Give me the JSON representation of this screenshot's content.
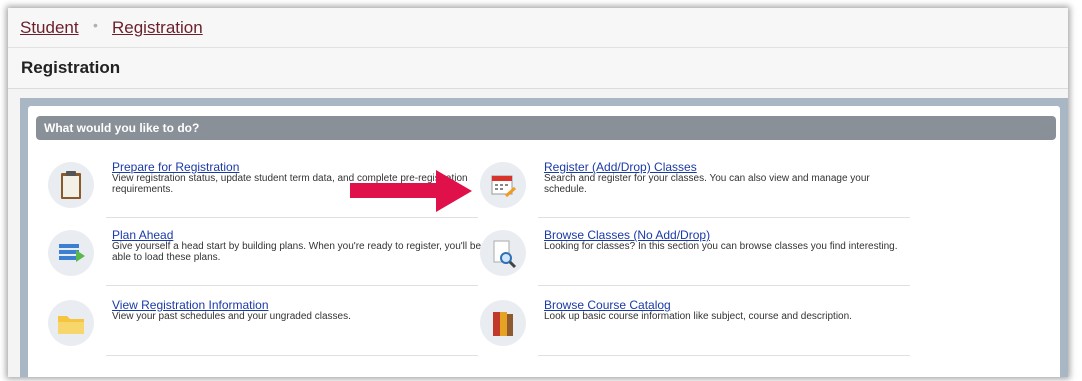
{
  "breadcrumb": {
    "student": "Student",
    "separator": "•",
    "registration": "Registration"
  },
  "page": {
    "title": "Registration"
  },
  "panel": {
    "header": "What would you like to do?"
  },
  "items": [
    {
      "title": "Prepare for Registration",
      "description": "View registration status, update student term data, and complete pre-registration requirements.",
      "icon": "clipboard-icon"
    },
    {
      "title": "Register (Add/Drop) Classes",
      "description": "Search and register for your classes. You can also view and manage your schedule.",
      "icon": "calendar-pencil-icon"
    },
    {
      "title": "Plan Ahead",
      "description": "Give yourself a head start by building plans. When you're ready to register, you'll be able to load these plans.",
      "icon": "plan-list-icon"
    },
    {
      "title": "Browse Classes (No Add/Drop)",
      "description": "Looking for classes? In this section you can browse classes you find interesting.",
      "icon": "magnifier-document-icon"
    },
    {
      "title": "View Registration Information",
      "description": "View your past schedules and your ungraded classes.",
      "icon": "folder-icon"
    },
    {
      "title": "Browse Course Catalog",
      "description": "Look up basic course information like subject, course and description.",
      "icon": "books-icon"
    }
  ],
  "colors": {
    "breadcrumb_link": "#6b1f2a",
    "item_link": "#1a3aa8",
    "panel_header": "#8a9098",
    "arrow": "#e0104a"
  }
}
